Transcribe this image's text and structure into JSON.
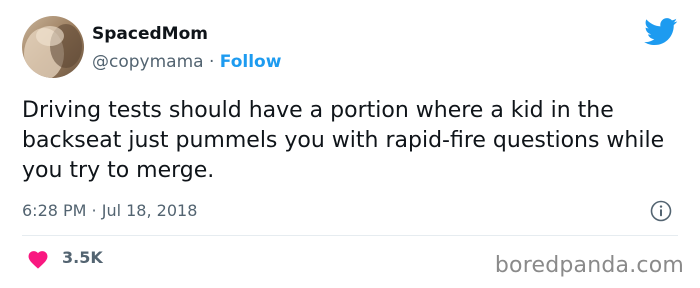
{
  "author": {
    "display_name": "SpacedMom",
    "handle": "@copymama",
    "separator": "·",
    "follow_label": "Follow"
  },
  "tweet": {
    "text": "Driving tests should have a portion where a kid in the backseat just pummels you with rapid-fire questions while you try to merge.",
    "timestamp": "6:28 PM · Jul 18, 2018",
    "like_count": "3.5K"
  },
  "icons": {
    "brand": "twitter-bird-icon",
    "info": "info-icon",
    "like": "heart-icon"
  },
  "colors": {
    "brand_blue": "#1d9bf0",
    "like_pink": "#f91880",
    "text_primary": "#0f1419",
    "text_secondary": "#536471"
  },
  "watermark": "boredpanda.com"
}
